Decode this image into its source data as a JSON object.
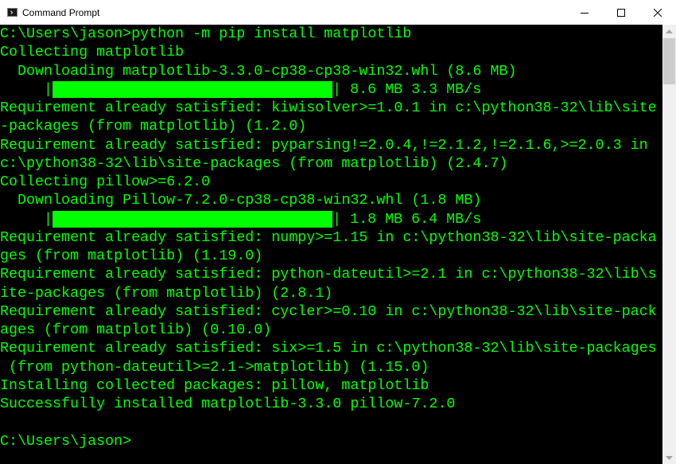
{
  "window": {
    "title": "Command Prompt",
    "icons": {
      "app": "command-prompt-icon",
      "minimize": "minimize-icon",
      "maximize": "maximize-icon",
      "close": "close-icon"
    }
  },
  "terminal": {
    "text_color": "#00ff00",
    "background": "#000000",
    "lines": [
      "C:\\Users\\jason>python -m pip install matplotlib",
      "Collecting matplotlib",
      "  Downloading matplotlib-3.3.0-cp38-cp38-win32.whl (8.6 MB)",
      "",
      "Requirement already satisfied: kiwisolver>=1.0.1 in c:\\python38-32\\lib\\site",
      "-packages (from matplotlib) (1.2.0)",
      "Requirement already satisfied: pyparsing!=2.0.4,!=2.1.2,!=2.1.6,>=2.0.3 in",
      "c:\\python38-32\\lib\\site-packages (from matplotlib) (2.4.7)",
      "Collecting pillow>=6.2.0",
      "  Downloading Pillow-7.2.0-cp38-cp38-win32.whl (1.8 MB)",
      "",
      "Requirement already satisfied: numpy>=1.15 in c:\\python38-32\\lib\\site-packa",
      "ges (from matplotlib) (1.19.0)",
      "Requirement already satisfied: python-dateutil>=2.1 in c:\\python38-32\\lib\\s",
      "ite-packages (from matplotlib) (2.8.1)",
      "Requirement already satisfied: cycler>=0.10 in c:\\python38-32\\lib\\site-pack",
      "ages (from matplotlib) (0.10.0)",
      "Requirement already satisfied: six>=1.5 in c:\\python38-32\\lib\\site-packages",
      " (from python-dateutil>=2.1->matplotlib) (1.15.0)",
      "Installing collected packages: pillow, matplotlib",
      "Successfully installed matplotlib-3.3.0 pillow-7.2.0",
      "",
      "C:\\Users\\jason>"
    ],
    "progress_bars": [
      {
        "line_index": 3,
        "fraction": 1.0,
        "stats": " 8.6 MB 3.3 MB/s"
      },
      {
        "line_index": 10,
        "fraction": 1.0,
        "stats": " 1.8 MB 6.4 MB/s"
      }
    ],
    "progress_prefix": "     |",
    "progress_suffix": "|"
  },
  "scrollbar": {
    "up_icon": "scroll-up-arrow-icon",
    "down_icon": "scroll-down-arrow-icon"
  }
}
